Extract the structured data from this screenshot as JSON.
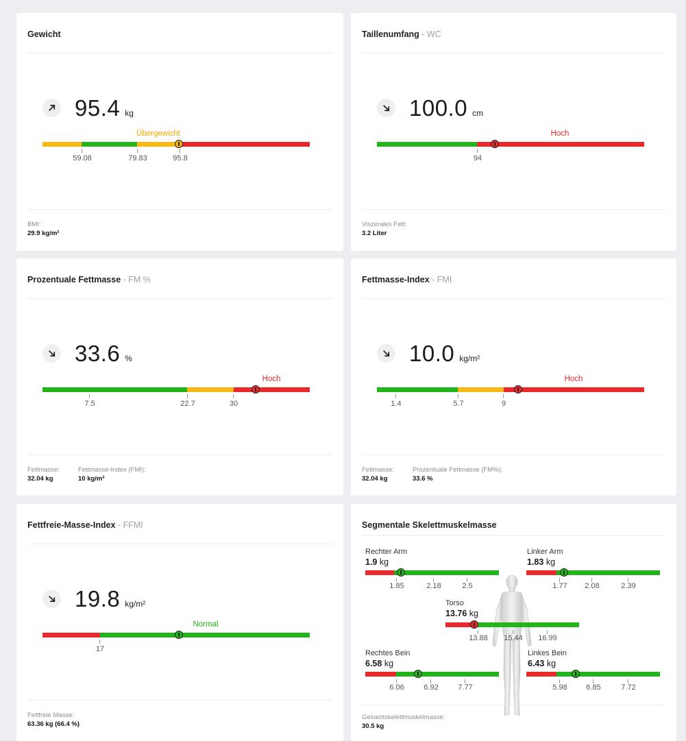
{
  "weight": {
    "title": "Gewicht",
    "subtitle": "",
    "trend": "up-right-arrow-icon",
    "value": "95.4",
    "unit": "kg",
    "status": "Übergewicht",
    "ticks": [
      "59.08",
      "79.83",
      "95.8"
    ],
    "footer": [
      {
        "label": "BMI:",
        "value": "29.9 kg/m²"
      }
    ]
  },
  "waist": {
    "title": "Taillenumfang",
    "subtitle": " - WC",
    "trend": "down-right-arrow-icon",
    "value": "100.0",
    "unit": "cm",
    "status": "Hoch",
    "ticks": [
      "94"
    ],
    "footer": [
      {
        "label": "Viszerales Fett:",
        "value": "3.2 Liter"
      }
    ]
  },
  "fat_percent": {
    "title": "Prozentuale Fettmasse",
    "subtitle": " - FM %",
    "trend": "down-right-arrow-icon",
    "value": "33.6",
    "unit": "%",
    "status": "Hoch",
    "ticks": [
      "7.5",
      "22.7",
      "30"
    ],
    "footer": [
      {
        "label": "Fettmasse:",
        "value": "32.04 kg"
      },
      {
        "label": "Fettmasse-Index (FMI):",
        "value": "10 kg/m²"
      }
    ]
  },
  "fmi": {
    "title": "Fettmasse-Index",
    "subtitle": " - FMI",
    "trend": "down-right-arrow-icon",
    "value": "10.0",
    "unit": "kg/m²",
    "status": "Hoch",
    "ticks": [
      "1.4",
      "5.7",
      "9"
    ],
    "footer": [
      {
        "label": "Fettmasse:",
        "value": "32.04 kg"
      },
      {
        "label": "Prozentuale Fettmasse (FM%):",
        "value": "33.6 %"
      }
    ]
  },
  "ffmi": {
    "title": "Fettfreie-Masse-Index",
    "subtitle": " - FFMI",
    "trend": "down-right-arrow-icon",
    "value": "19.8",
    "unit": "kg/m²",
    "status": "Normal",
    "ticks": [
      "17"
    ],
    "footer": [
      {
        "label": "Fettfreie Masse:",
        "value": "63.36 kg (66.4 %)"
      }
    ]
  },
  "segmental": {
    "title": "Segmentale Skelettmuskelmasse",
    "right_arm": {
      "name": "Rechter Arm",
      "value": "1.9",
      "unit": "kg",
      "ticks": [
        "1.85",
        "2.18",
        "2.5"
      ]
    },
    "left_arm": {
      "name": "Linker Arm",
      "value": "1.83",
      "unit": "kg",
      "ticks": [
        "1.77",
        "2.08",
        "2.39"
      ]
    },
    "torso": {
      "name": "Torso",
      "value": "13.76",
      "unit": "kg",
      "ticks": [
        "13.88",
        "15.44",
        "16.99"
      ]
    },
    "right_leg": {
      "name": "Rechtes Bein",
      "value": "6.58",
      "unit": "kg",
      "ticks": [
        "6.06",
        "6.92",
        "7.77"
      ]
    },
    "left_leg": {
      "name": "Linkes Bein",
      "value": "6.43",
      "unit": "kg",
      "ticks": [
        "5.98",
        "6.85",
        "7.72"
      ]
    },
    "footer": [
      {
        "label": "Gesamtskelettmuskelmasse:",
        "value": "30.5 kg"
      }
    ]
  },
  "colors": {
    "green": "#23b31a",
    "orange": "#f7b915",
    "red": "#e92a2c"
  }
}
